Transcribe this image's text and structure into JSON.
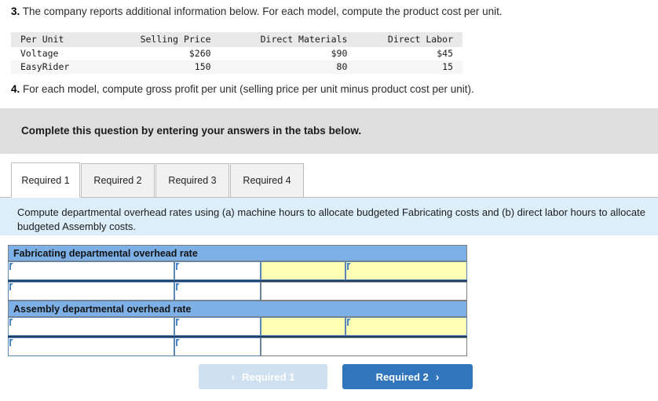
{
  "questions": {
    "q3_num": "3.",
    "q3_text": "The company reports additional information below. For each model, compute the product cost per unit.",
    "q4_num": "4.",
    "q4_text": "For each model, compute gross profit per unit (selling price per unit minus product cost per unit)."
  },
  "data_table": {
    "headers": [
      "Per Unit",
      "Selling Price",
      "Direct Materials",
      "Direct Labor"
    ],
    "rows": [
      {
        "label": "Voltage",
        "selling_price": "$260",
        "direct_materials": "$90",
        "direct_labor": "$45"
      },
      {
        "label": "EasyRider",
        "selling_price": "150",
        "direct_materials": "80",
        "direct_labor": "15"
      }
    ]
  },
  "banner": {
    "text": "Complete this question by entering your answers in the tabs below."
  },
  "tabs": {
    "items": [
      {
        "label": "Required 1",
        "active": true
      },
      {
        "label": "Required 2",
        "active": false
      },
      {
        "label": "Required 3",
        "active": false
      },
      {
        "label": "Required 4",
        "active": false
      }
    ]
  },
  "instruction_panel": {
    "text": "Compute departmental overhead rates using (a) machine hours to allocate budgeted Fabricating costs and (b) direct labor hours to allocate budgeted Assembly costs."
  },
  "answer_grid": {
    "sections": [
      {
        "header": "Fabricating departmental overhead rate",
        "row1": {
          "c1": "",
          "c2": "",
          "c3": "",
          "c4": ""
        },
        "row2": {
          "c1": "",
          "c2": "",
          "c34": ""
        }
      },
      {
        "header": "Assembly departmental overhead rate",
        "row1": {
          "c1": "",
          "c2": "",
          "c3": "",
          "c4": ""
        },
        "row2": {
          "c1": "",
          "c2": "",
          "c34": ""
        }
      }
    ]
  },
  "nav": {
    "prev_label": "Required 1",
    "next_label": "Required 2",
    "prev_icon": "chevron-left",
    "next_icon": "chevron-right",
    "prev_glyph": "‹",
    "next_glyph": "›"
  },
  "colors": {
    "banner_gray": "#dededf",
    "panel_blue": "#ddeefb",
    "grid_header_blue": "#7db0e6",
    "input_yellow": "#ffffb3",
    "button_active_blue": "#3175bd",
    "button_disabled_blue": "#cfe0f0",
    "marker_blue": "#4a86c8"
  }
}
